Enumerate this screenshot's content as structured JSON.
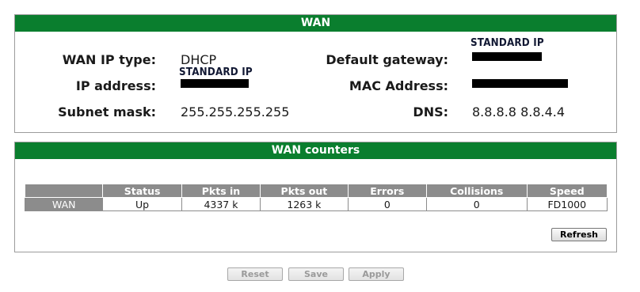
{
  "wan": {
    "title": "WAN",
    "wan_ip_type_label": "WAN IP type:",
    "wan_ip_type_value": "DHCP",
    "ip_address_label": "IP address:",
    "ip_address_note": "STANDARD IP",
    "subnet_mask_label": "Subnet mask:",
    "subnet_mask_value": "255.255.255.255",
    "default_gateway_label": "Default gateway:",
    "default_gateway_note": "STANDARD IP",
    "mac_address_label": "MAC Address:",
    "dns_label": "DNS:",
    "dns_value": "8.8.8.8 8.8.4.4"
  },
  "counters": {
    "title": "WAN counters",
    "columns": [
      "",
      "Status",
      "Pkts in",
      "Pkts out",
      "Errors",
      "Collisions",
      "Speed"
    ],
    "rows": [
      {
        "name": "WAN",
        "status": "Up",
        "pkts_in": "4337 k",
        "pkts_out": "1263 k",
        "errors": "0",
        "collisions": "0",
        "speed": "FD1000"
      }
    ],
    "refresh_label": "Refresh"
  },
  "footer": {
    "reset_label": "Reset",
    "save_label": "Save",
    "apply_label": "Apply"
  },
  "colors": {
    "header_green": "#0a7e2e",
    "table_header_gray": "#8c8c8c",
    "redaction_black": "#000000"
  }
}
